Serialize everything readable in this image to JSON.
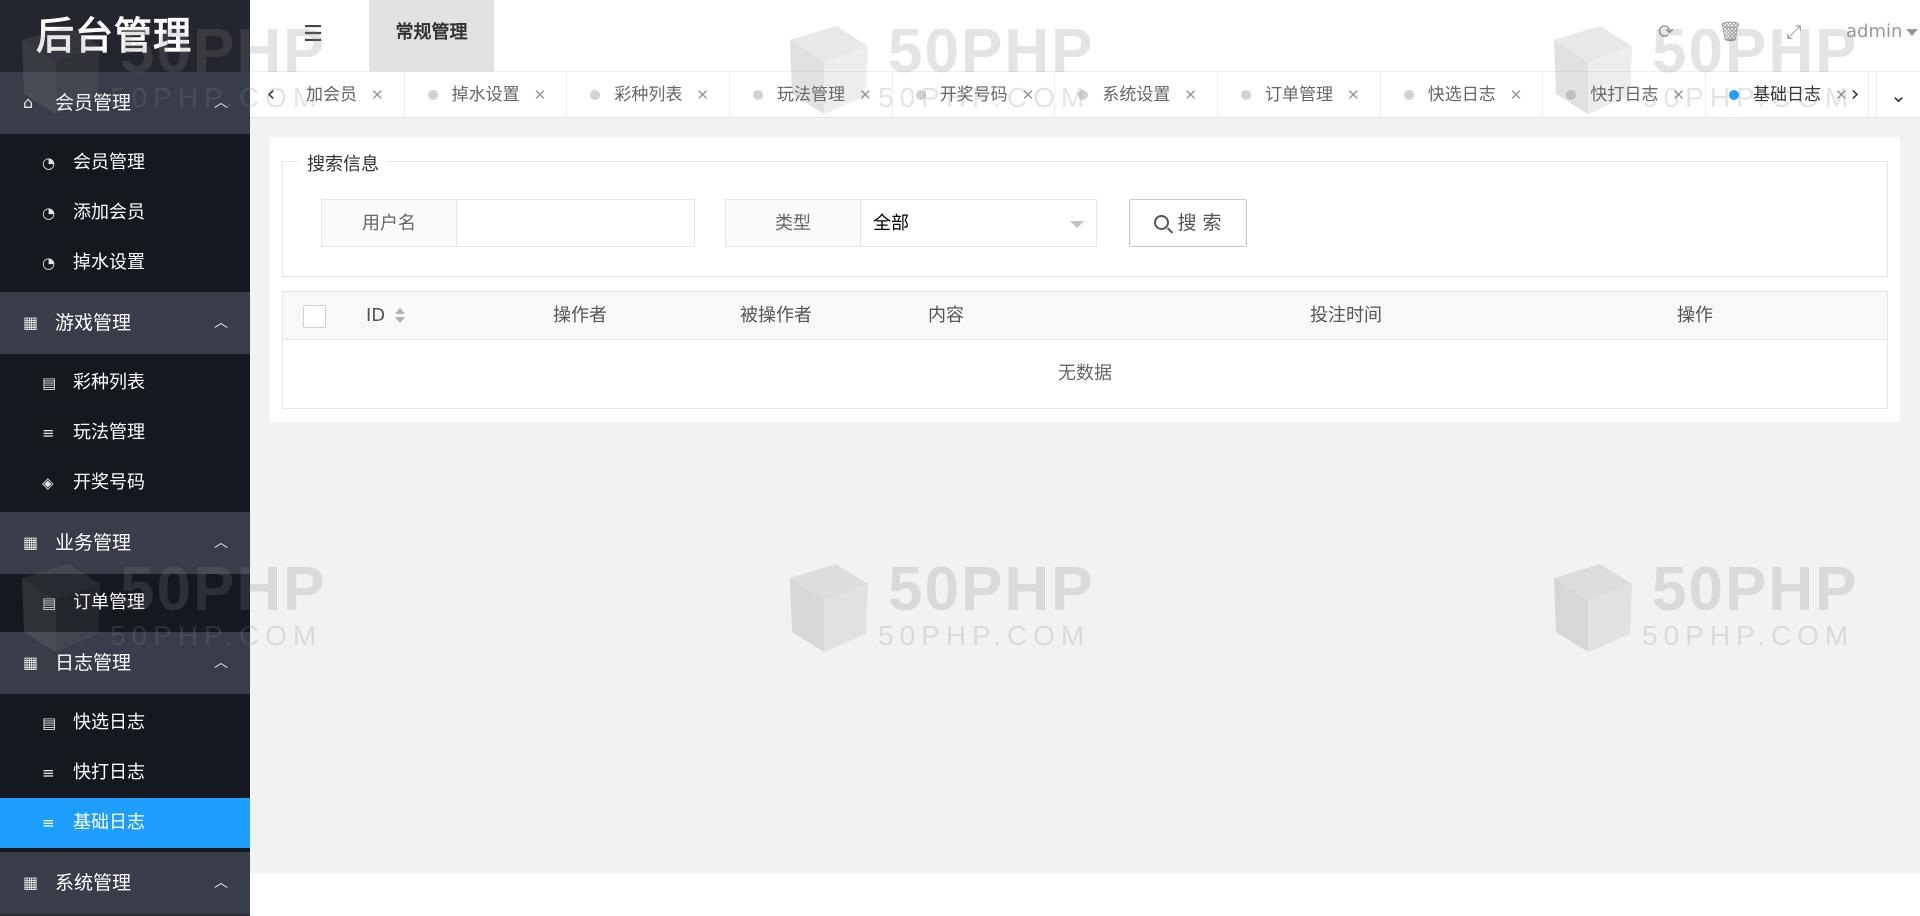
{
  "sidebar": {
    "logo": "后台管理",
    "groups": [
      {
        "title": "会员管理",
        "icon": "home-icon",
        "items": [
          {
            "label": "会员管理",
            "icon": "dashboard-icon"
          },
          {
            "label": "添加会员",
            "icon": "dashboard-icon"
          },
          {
            "label": "掉水设置",
            "icon": "dashboard-icon"
          }
        ]
      },
      {
        "title": "游戏管理",
        "icon": "calendar-icon",
        "items": [
          {
            "label": "彩种列表",
            "icon": "list-alt-icon"
          },
          {
            "label": "玩法管理",
            "icon": "bars-icon"
          },
          {
            "label": "开奖号码",
            "icon": "tags-icon"
          }
        ]
      },
      {
        "title": "业务管理",
        "icon": "calendar-icon",
        "items": [
          {
            "label": "订单管理",
            "icon": "list-alt-icon"
          }
        ]
      },
      {
        "title": "日志管理",
        "icon": "calendar-icon",
        "items": [
          {
            "label": "快选日志",
            "icon": "list-alt-icon"
          },
          {
            "label": "快打日志",
            "icon": "bars-icon"
          },
          {
            "label": "基础日志",
            "icon": "bars-icon",
            "active": true
          }
        ]
      },
      {
        "title": "系统管理",
        "icon": "calendar-icon",
        "items": []
      }
    ]
  },
  "header": {
    "active_tab": "常规管理",
    "user": "admin",
    "icons": [
      "menu-icon",
      "refresh-icon",
      "trash-icon",
      "fullscreen-icon"
    ]
  },
  "tabs": [
    {
      "label": "加会员",
      "first": true
    },
    {
      "label": "掉水设置"
    },
    {
      "label": "彩种列表"
    },
    {
      "label": "玩法管理"
    },
    {
      "label": "开奖号码"
    },
    {
      "label": "系统设置"
    },
    {
      "label": "订单管理"
    },
    {
      "label": "快选日志"
    },
    {
      "label": "快打日志"
    },
    {
      "label": "基础日志",
      "active": true
    }
  ],
  "search": {
    "legend": "搜索信息",
    "username_label": "用户名",
    "username_value": "",
    "type_label": "类型",
    "type_value": "全部",
    "button_label": "搜 索"
  },
  "table": {
    "columns": [
      "ID",
      "操作者",
      "被操作者",
      "内容",
      "投注时间",
      "操作"
    ],
    "empty_text": "无数据"
  },
  "watermark": {
    "big": "50PHP",
    "small": "50PHP.COM"
  },
  "colors": {
    "sidebar_bg": "#282b33",
    "active_blue": "#1e9fff",
    "main_bg": "#f2f2f2"
  }
}
